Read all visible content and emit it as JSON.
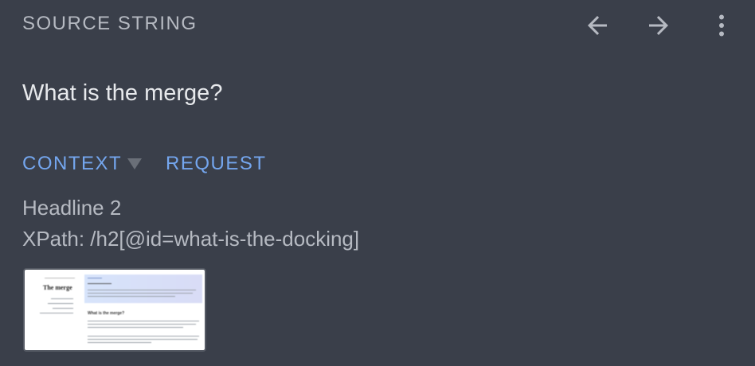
{
  "header": {
    "label": "SOURCE STRING",
    "back_icon": "arrow-left-icon",
    "forward_icon": "arrow-right-icon",
    "more_icon": "more-vertical-icon"
  },
  "source": {
    "text": "What is the merge?"
  },
  "tabs": {
    "context": "CONTEXT",
    "request": "REQUEST"
  },
  "context": {
    "element_type": "Headline 2",
    "xpath": "XPath: /h2[@id=what-is-the-docking]"
  },
  "screenshot_thumbnail": {
    "page_title": "The merge",
    "section_heading": "What is the merge?"
  },
  "colors": {
    "background": "#3a3f4a",
    "muted_text": "#b6bac2",
    "primary_text": "#e7e9ec",
    "accent": "#74a6ee"
  }
}
